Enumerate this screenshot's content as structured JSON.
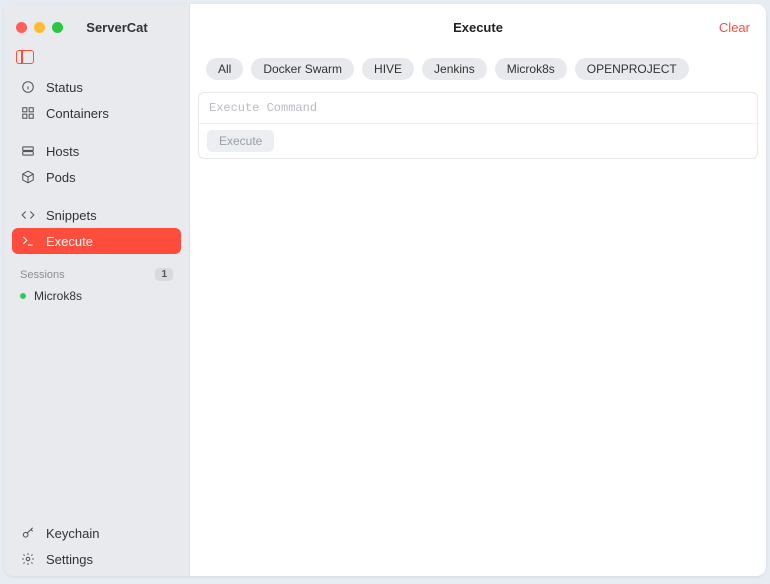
{
  "app": {
    "title": "ServerCat"
  },
  "sidebar": {
    "nav": [
      {
        "id": "status",
        "label": "Status",
        "icon": "info-icon"
      },
      {
        "id": "containers",
        "label": "Containers",
        "icon": "grid-icon"
      },
      {
        "id": "hosts",
        "label": "Hosts",
        "icon": "server-icon"
      },
      {
        "id": "pods",
        "label": "Pods",
        "icon": "cube-icon"
      },
      {
        "id": "snippets",
        "label": "Snippets",
        "icon": "code-icon"
      },
      {
        "id": "execute",
        "label": "Execute",
        "icon": "terminal-icon"
      }
    ],
    "footer": [
      {
        "id": "keychain",
        "label": "Keychain",
        "icon": "key-icon"
      },
      {
        "id": "settings",
        "label": "Settings",
        "icon": "gear-icon"
      }
    ],
    "sessions_label": "Sessions",
    "sessions_count": "1",
    "sessions": [
      {
        "label": "Microk8s",
        "status": "online"
      }
    ]
  },
  "main": {
    "title": "Execute",
    "clear_label": "Clear",
    "chips": [
      "All",
      "Docker Swarm",
      "HIVE",
      "Jenkins",
      "Microk8s",
      "OPENPROJECT"
    ],
    "cmd_placeholder": "Execute Command",
    "execute_label": "Execute"
  },
  "colors": {
    "accent": "#ff4d3d"
  }
}
